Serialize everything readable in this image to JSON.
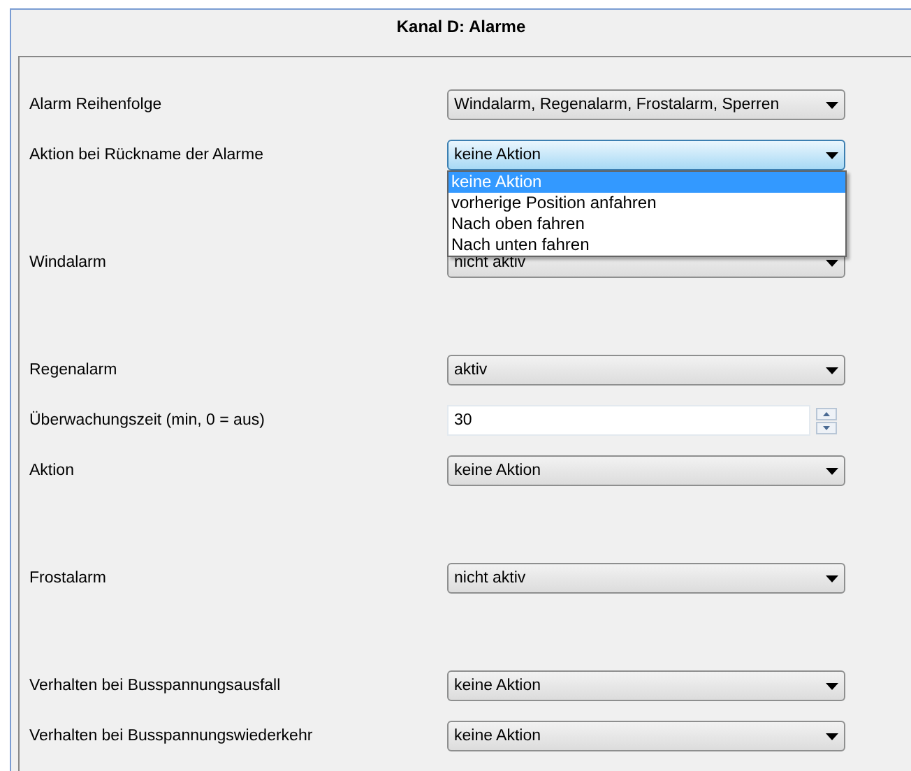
{
  "header": {
    "title": "Kanal D: Alarme"
  },
  "groups": [
    {
      "rows": [
        {
          "label": "Alarm Reihenfolge",
          "kind": "combo",
          "value": "Windalarm, Regenalarm, Frostalarm, Sperren",
          "focused": false
        },
        {
          "label": "Aktion bei Rückname der Alarme",
          "kind": "combo",
          "value": "keine Aktion",
          "focused": true,
          "expanded": true,
          "options": [
            {
              "label": "keine Aktion",
              "selected": true
            },
            {
              "label": "vorherige Position anfahren",
              "selected": false
            },
            {
              "label": "Nach oben fahren",
              "selected": false
            },
            {
              "label": "Nach unten fahren",
              "selected": false
            }
          ]
        }
      ]
    },
    {
      "rows": [
        {
          "label": "Windalarm",
          "kind": "combo",
          "value": "nicht aktiv",
          "focused": false
        }
      ]
    },
    {
      "rows": [
        {
          "label": "Regenalarm",
          "kind": "combo",
          "value": "aktiv",
          "focused": false
        },
        {
          "label": "Überwachungszeit (min, 0 = aus)",
          "kind": "spin",
          "value": "30"
        },
        {
          "label": "Aktion",
          "kind": "combo",
          "value": "keine Aktion",
          "focused": false
        }
      ]
    },
    {
      "rows": [
        {
          "label": "Frostalarm",
          "kind": "combo",
          "value": "nicht aktiv",
          "focused": false
        }
      ]
    },
    {
      "rows": [
        {
          "label": "Verhalten bei Busspannungsausfall",
          "kind": "combo",
          "value": "keine Aktion",
          "focused": false
        },
        {
          "label": "Verhalten bei Busspannungswiederkehr",
          "kind": "combo",
          "value": "keine Aktion",
          "focused": false
        }
      ]
    }
  ]
}
